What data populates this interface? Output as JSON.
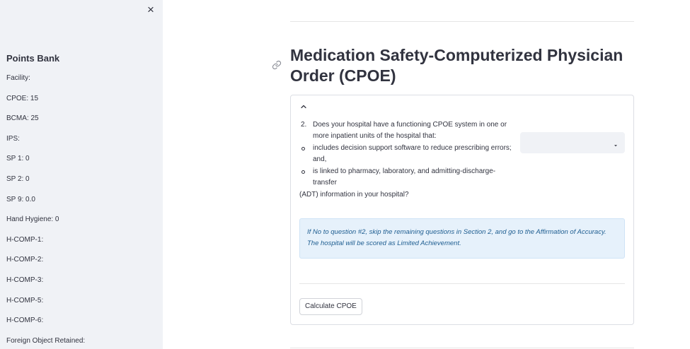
{
  "sidebar": {
    "close_label": "×",
    "title": "Points Bank",
    "items": [
      "Facility:",
      "CPOE: 15",
      "BCMA: 25",
      "IPS:",
      "SP 1: 0",
      "SP 2: 0",
      "SP 9: 0.0",
      "Hand Hygiene: 0",
      "H-COMP-1:",
      "H-COMP-2:",
      "H-COMP-3:",
      "H-COMP-5:",
      "H-COMP-6:",
      "Foreign Object Retained:"
    ]
  },
  "main": {
    "title": "Medication Safety-Computerized Physician Order (CPOE)",
    "question": {
      "number": "2.",
      "text": "Does your hospital have a functioning CPOE system in one or more inpatient units of the hospital that:",
      "bullets": [
        "includes decision support software to reduce prescribing errors; and,",
        "is linked to pharmacy, laboratory, and admitting-discharge-transfer"
      ],
      "tail": "(ADT) information in your hospital?"
    },
    "select": {
      "value": ""
    },
    "info": "If No to question #2, skip the remaining questions in Section 2, and go to the Affirmation of Accuracy. The hospital will be scored as Limited Achievement.",
    "calculate_label": "Calculate CPOE"
  },
  "icons": {
    "close": "close-icon",
    "anchor": "link-icon",
    "chevron": "chevron-up-icon",
    "caret": "caret-down-icon"
  },
  "colors": {
    "sidebar_bg": "#f0f2f6",
    "info_bg": "#e6f1fb",
    "info_text": "#1f5e91",
    "text": "#31333f"
  }
}
